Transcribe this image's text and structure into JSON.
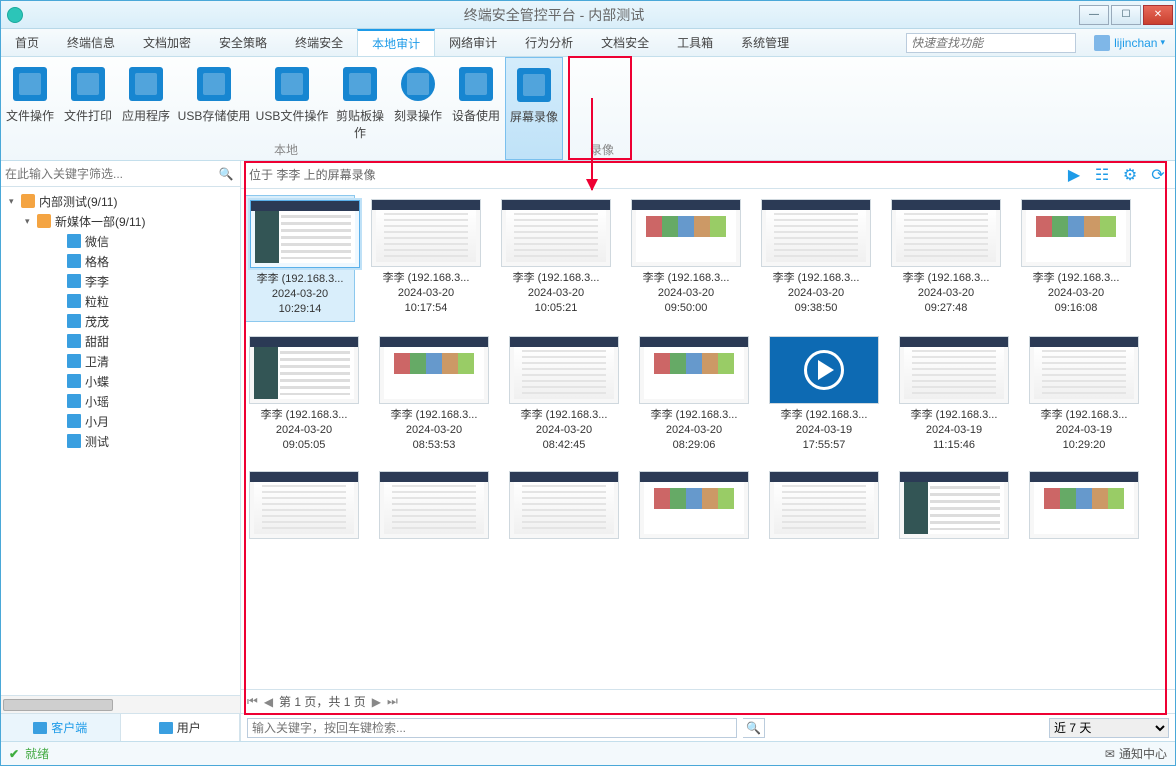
{
  "window": {
    "title": "终端安全管控平台 - 内部测试"
  },
  "menus": [
    "首页",
    "终端信息",
    "文档加密",
    "安全策略",
    "终端安全",
    "本地审计",
    "网络审计",
    "行为分析",
    "文档安全",
    "工具箱",
    "系统管理"
  ],
  "menu_active_index": 5,
  "quick_search_placeholder": "快速查找功能",
  "user": {
    "name": "lijinchan"
  },
  "ribbon": {
    "buttons": [
      "文件操作",
      "文件打印",
      "应用程序",
      "USB存储使用",
      "USB文件操作",
      "剪贴板操作",
      "刻录操作",
      "设备使用",
      "屏幕录像"
    ],
    "active_index": 8,
    "group_labels": [
      "本地",
      "录像"
    ]
  },
  "sidebar": {
    "filter_placeholder": "在此输入关键字筛选...",
    "tabs": [
      "客户端",
      "用户"
    ],
    "tab_active_index": 0,
    "tree": [
      {
        "depth": 0,
        "kind": "org",
        "expander": "▾",
        "label": "内部测试(9/11)"
      },
      {
        "depth": 1,
        "kind": "org",
        "expander": "▾",
        "label": "新媒体一部(9/11)"
      },
      {
        "depth": 2,
        "kind": "pc",
        "label": "微信"
      },
      {
        "depth": 2,
        "kind": "pc",
        "label": "格格"
      },
      {
        "depth": 2,
        "kind": "pc",
        "label": "李李",
        "selected": true
      },
      {
        "depth": 2,
        "kind": "pc",
        "label": "粒粒"
      },
      {
        "depth": 2,
        "kind": "pc",
        "label": "茂茂"
      },
      {
        "depth": 2,
        "kind": "pc",
        "label": "甜甜"
      },
      {
        "depth": 2,
        "kind": "pc",
        "label": "卫清"
      },
      {
        "depth": 2,
        "kind": "pc",
        "label": "小蝶"
      },
      {
        "depth": 2,
        "kind": "pc",
        "label": "小瑶"
      },
      {
        "depth": 2,
        "kind": "pc",
        "label": "小月"
      },
      {
        "depth": 2,
        "kind": "pc",
        "label": "测试"
      }
    ]
  },
  "content": {
    "crumb": "位于 李李 上的屏幕录像",
    "items": [
      {
        "name": "李李 (192.168.3...",
        "date": "2024-03-20",
        "time": "10:29:14",
        "selected": true,
        "thumb": "a"
      },
      {
        "name": "李李 (192.168.3...",
        "date": "2024-03-20",
        "time": "10:17:54",
        "thumb": "b"
      },
      {
        "name": "李李 (192.168.3...",
        "date": "2024-03-20",
        "time": "10:05:21",
        "thumb": "b"
      },
      {
        "name": "李李 (192.168.3...",
        "date": "2024-03-20",
        "time": "09:50:00",
        "thumb": "c"
      },
      {
        "name": "李李 (192.168.3...",
        "date": "2024-03-20",
        "time": "09:38:50",
        "thumb": "b"
      },
      {
        "name": "李李 (192.168.3...",
        "date": "2024-03-20",
        "time": "09:27:48",
        "thumb": "b"
      },
      {
        "name": "李李 (192.168.3...",
        "date": "2024-03-20",
        "time": "09:16:08",
        "thumb": "c"
      },
      {
        "name": "李李 (192.168.3...",
        "date": "2024-03-20",
        "time": "09:05:05",
        "thumb": "a"
      },
      {
        "name": "李李 (192.168.3...",
        "date": "2024-03-20",
        "time": "08:53:53",
        "thumb": "c"
      },
      {
        "name": "李李 (192.168.3...",
        "date": "2024-03-20",
        "time": "08:42:45",
        "thumb": "b"
      },
      {
        "name": "李李 (192.168.3...",
        "date": "2024-03-20",
        "time": "08:29:06",
        "thumb": "c"
      },
      {
        "name": "李李 (192.168.3...",
        "date": "2024-03-19",
        "time": "17:55:57",
        "thumb": "video"
      },
      {
        "name": "李李 (192.168.3...",
        "date": "2024-03-19",
        "time": "11:15:46",
        "thumb": "b"
      },
      {
        "name": "李李 (192.168.3...",
        "date": "2024-03-19",
        "time": "10:29:20",
        "thumb": "b"
      },
      {
        "name": "",
        "date": "",
        "time": "",
        "thumb": "b"
      },
      {
        "name": "",
        "date": "",
        "time": "",
        "thumb": "b"
      },
      {
        "name": "",
        "date": "",
        "time": "",
        "thumb": "b"
      },
      {
        "name": "",
        "date": "",
        "time": "",
        "thumb": "c"
      },
      {
        "name": "",
        "date": "",
        "time": "",
        "thumb": "b"
      },
      {
        "name": "",
        "date": "",
        "time": "",
        "thumb": "a"
      },
      {
        "name": "",
        "date": "",
        "time": "",
        "thumb": "c"
      }
    ],
    "pager_text": "第 1 页，共 1 页",
    "keyword_placeholder": "输入关键字，按回车键检索...",
    "range_selected": "近 7 天"
  },
  "status": {
    "text": "就绪",
    "notify": "通知中心"
  }
}
